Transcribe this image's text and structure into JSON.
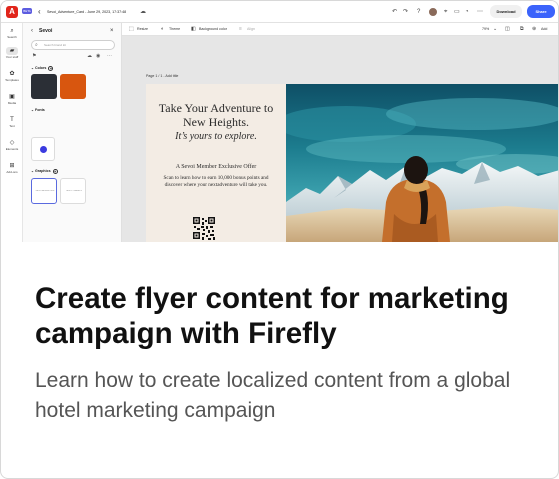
{
  "app": {
    "beta_badge": "BETA",
    "document_title": "Sevoi_Adventure_Card - June 29, 2023, 17:37:48",
    "download_label": "Download",
    "share_label": "Share",
    "logo_glyph": "A",
    "accent_color": "#3b63fb",
    "brand_color": "#e1251b"
  },
  "rail": {
    "items": [
      {
        "label": "Search",
        "icon": "search-icon"
      },
      {
        "label": "Your stuff",
        "icon": "folder-icon"
      },
      {
        "label": "Templates",
        "icon": "templates-icon"
      },
      {
        "label": "Media",
        "icon": "media-icon"
      },
      {
        "label": "Text",
        "icon": "text-icon"
      },
      {
        "label": "Elements",
        "icon": "elements-icon"
      },
      {
        "label": "Add-ons",
        "icon": "addons-icon"
      }
    ]
  },
  "panel": {
    "title": "Sevoi",
    "search_placeholder": "Search brand kit",
    "sections": {
      "colors": "Colors",
      "fonts": "Fonts",
      "graphics": "Graphics"
    },
    "colors": [
      "#2b2f36",
      "#d8560f"
    ],
    "graphics": [
      {
        "label": "SEVOI ADVENTURE"
      },
      {
        "label": "SEVOI TRAVELS"
      }
    ]
  },
  "canvas_toolbar": {
    "resize": "Resize",
    "theme": "Theme",
    "background_color": "Background color",
    "align": "Align",
    "zoom": "79%",
    "add": "Add"
  },
  "canvas": {
    "page_label": "Page 1 / 1 - Add title"
  },
  "flyer": {
    "headline": "Take Your Adventure to New Heights.",
    "tagline": "It’s yours to explore.",
    "offer_title": "A Sevoi Member Exclusive Offer",
    "offer_body": "Scan to learn how to earn 10,000 bonus points and discover where your nextadventure will take you."
  },
  "article": {
    "title": "Create flyer content for marketing campaign with Firefly",
    "description": "Learn how to create localized content from a global hotel marketing campaign"
  }
}
